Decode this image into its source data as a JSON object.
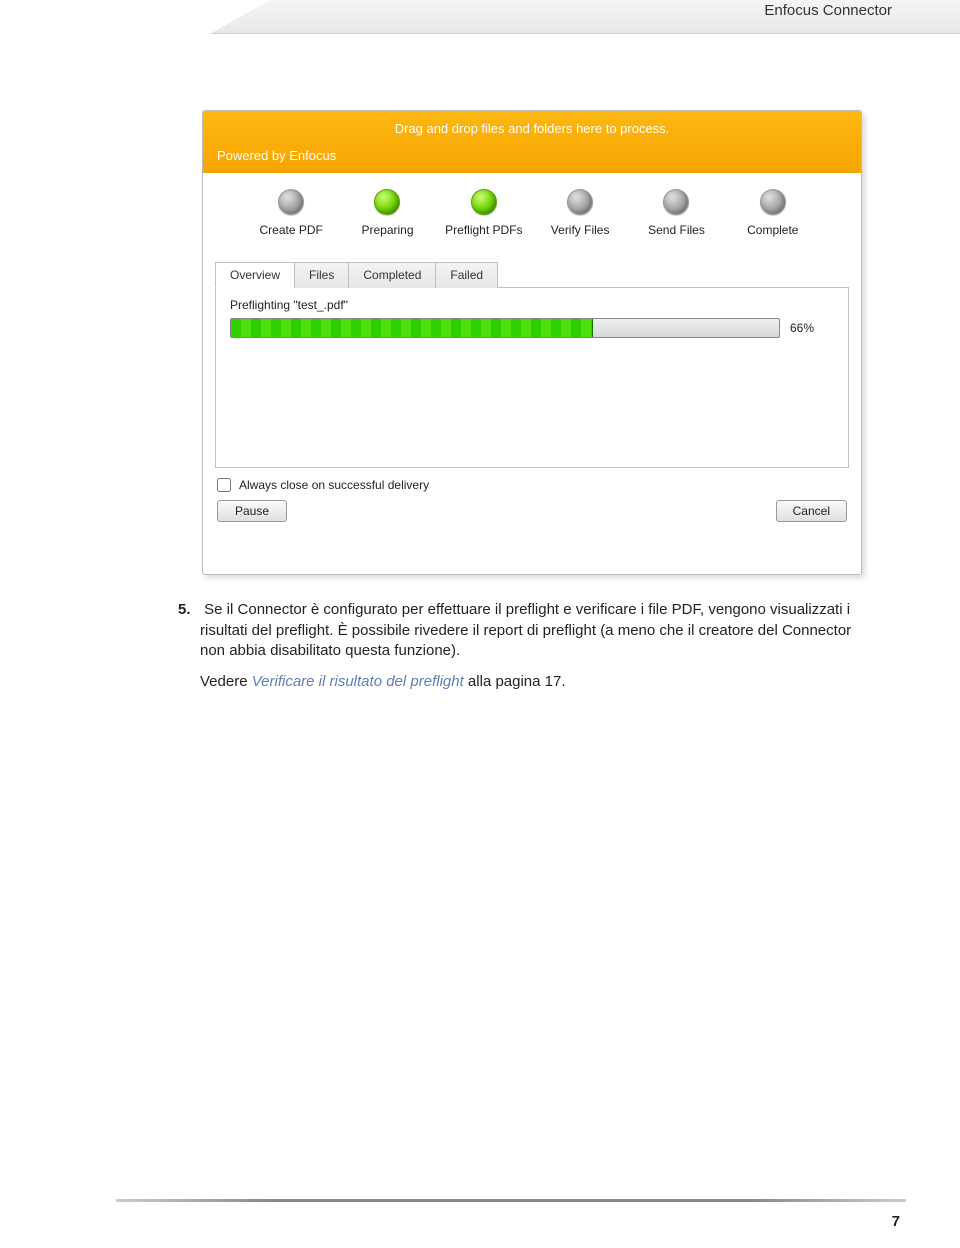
{
  "header": {
    "title": "Enfocus Connector"
  },
  "screenshot": {
    "drag_text": "Drag and drop files and folders here to process.",
    "powered_text": "Powered by Enfocus",
    "stages": [
      {
        "label": "Create PDF",
        "active": false
      },
      {
        "label": "Preparing",
        "active": true
      },
      {
        "label": "Preflight PDFs",
        "active": true
      },
      {
        "label": "Verify Files",
        "active": false
      },
      {
        "label": "Send Files",
        "active": false
      },
      {
        "label": "Complete",
        "active": false
      }
    ],
    "tabs": [
      {
        "label": "Overview",
        "active": true
      },
      {
        "label": "Files",
        "active": false
      },
      {
        "label": "Completed",
        "active": false
      },
      {
        "label": "Failed",
        "active": false
      }
    ],
    "progress": {
      "status_text": "Preflighting \"test_.pdf\"",
      "percent": 66,
      "percent_label": "66%"
    },
    "close_checkbox_label": "Always close on successful delivery",
    "pause_label": "Pause",
    "cancel_label": "Cancel"
  },
  "doc": {
    "item_number": "5.",
    "para1": "Se il Connector è configurato per effettuare il preflight e verificare i file PDF, vengono visualizzati i risultati del preflight. È possibile rivedere il report di preflight (a meno che il creatore del Connector non abbia disabilitato questa funzione).",
    "see_prefix": "Vedere ",
    "see_link": "Verificare il risultato del preflight",
    "see_suffix": " alla pagina 17."
  },
  "page_number": "7"
}
